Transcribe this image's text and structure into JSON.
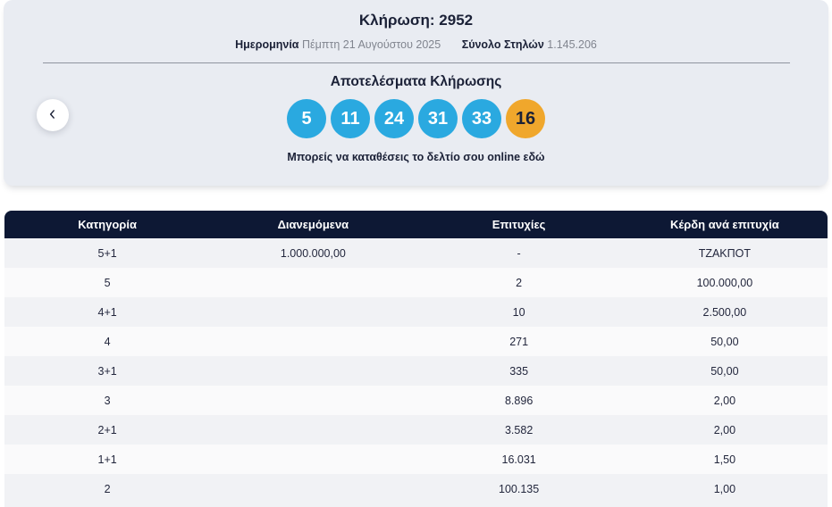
{
  "header": {
    "title": "Κλήρωση: 2952",
    "date_label": "Ημερομηνία",
    "date_value": "Πέμπτη 21 Αυγούστου 2025",
    "columns_label": "Σύνολο Στηλών",
    "columns_value": "1.145.206"
  },
  "results": {
    "title": "Αποτελέσματα Κλήρωσης",
    "numbers": [
      "5",
      "11",
      "24",
      "31",
      "33"
    ],
    "joker": "16",
    "deposit_text": "Μπορείς να καταθέσεις το δελτίο σου online εδώ"
  },
  "table": {
    "headers": [
      "Κατηγορία",
      "Διανεμόμενα",
      "Επιτυχίες",
      "Κέρδη ανά επιτυχία"
    ],
    "rows": [
      [
        "5+1",
        "1.000.000,00",
        "-",
        "ΤΖΑΚΠΟΤ"
      ],
      [
        "5",
        "",
        "2",
        "100.000,00"
      ],
      [
        "4+1",
        "",
        "10",
        "2.500,00"
      ],
      [
        "4",
        "",
        "271",
        "50,00"
      ],
      [
        "3+1",
        "",
        "335",
        "50,00"
      ],
      [
        "3",
        "",
        "8.896",
        "2,00"
      ],
      [
        "2+1",
        "",
        "3.582",
        "2,00"
      ],
      [
        "1+1",
        "",
        "16.031",
        "1,50"
      ],
      [
        "2",
        "",
        "100.135",
        "1,00"
      ]
    ]
  },
  "colors": {
    "ball_blue": "#2aa9e0",
    "ball_orange": "#f0a72c",
    "header_navy": "#0d1834",
    "banner_bg": "#e9ecf2"
  }
}
